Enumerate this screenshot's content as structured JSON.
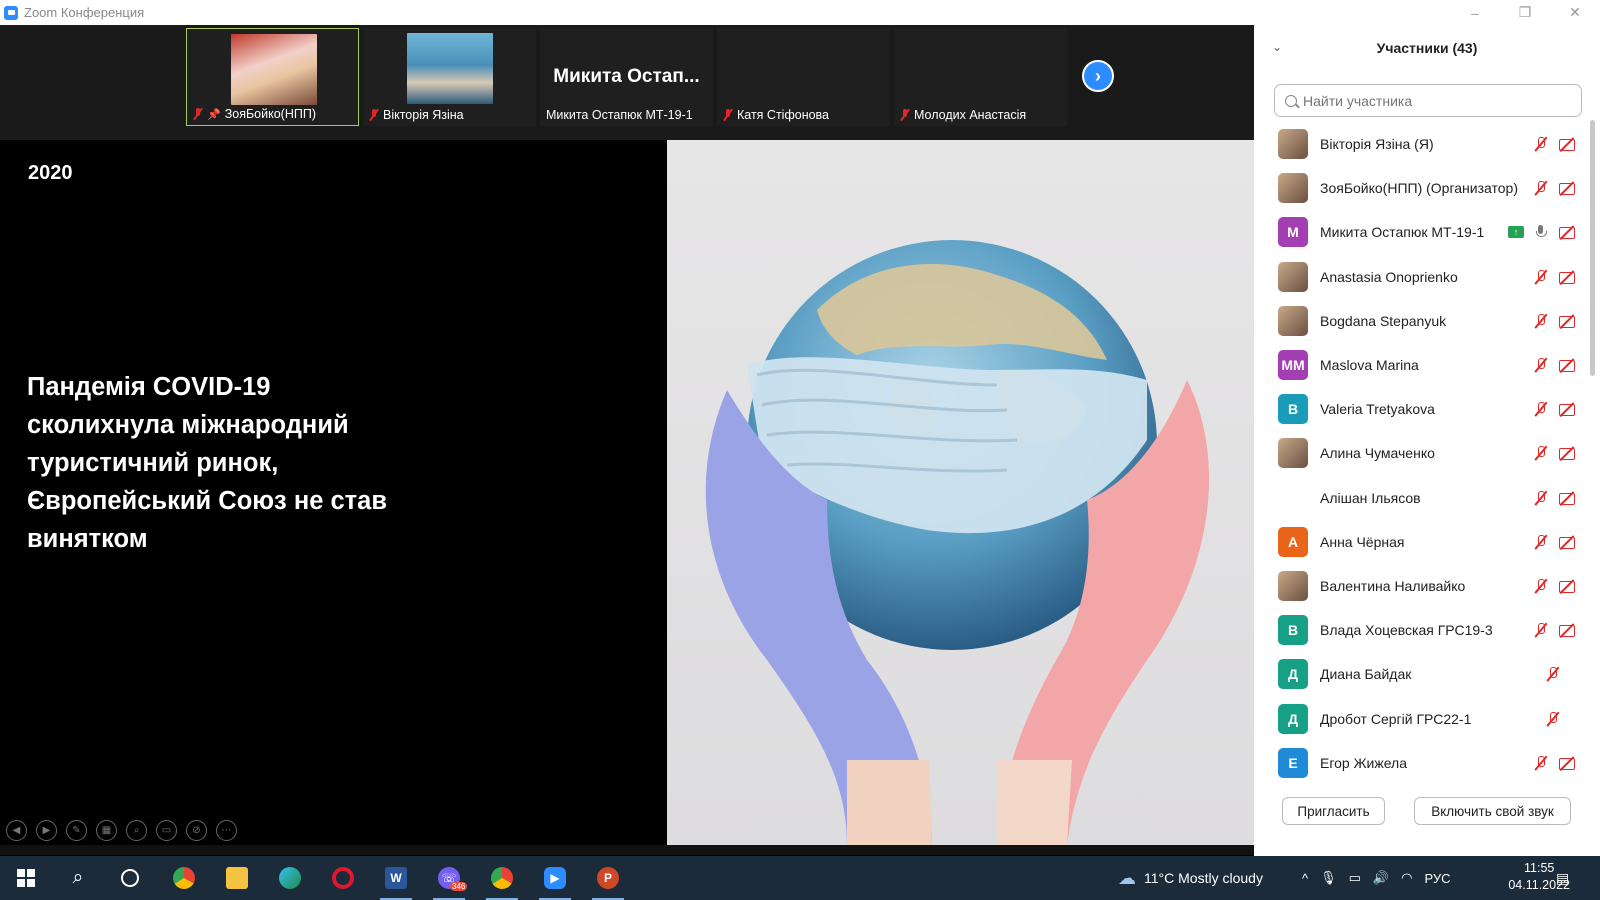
{
  "window": {
    "title": "Zoom Конференция"
  },
  "video_strip": {
    "tiles": [
      {
        "name": "ЗояБойко(НПП)",
        "big_name": "",
        "muted": true,
        "pinned": true,
        "has_video": true
      },
      {
        "name": "Вікторія Язіна",
        "big_name": "",
        "muted": true,
        "pinned": false,
        "has_video": true
      },
      {
        "name": "Микита Остапюк МТ-19-1",
        "big_name": "Микита Остап...",
        "muted": false,
        "pinned": false,
        "has_video": false
      },
      {
        "name": "Катя Стіфонова",
        "big_name": "",
        "muted": true,
        "pinned": false,
        "has_video": false
      },
      {
        "name": "Молодих Анастасія",
        "big_name": "",
        "muted": true,
        "pinned": false,
        "has_video": false
      }
    ]
  },
  "slide": {
    "year": "2020",
    "headline": "Пандемія COVID-19 сколихнула міжнародний туристичний ринок, Європейський Союз не став винятком"
  },
  "participants": {
    "title": "Участники (43)",
    "search_placeholder": "Найти участника",
    "list": [
      {
        "name": "Вікторія Язіна (Я)",
        "avatar": "",
        "avatar_color": "",
        "photo": true,
        "mic": "off",
        "cam": "off",
        "share": false
      },
      {
        "name": "ЗояБойко(НПП) (Организатор)",
        "avatar": "",
        "avatar_color": "",
        "photo": true,
        "mic": "off",
        "cam": "off",
        "share": false
      },
      {
        "name": "Микита Остапюк МТ-19-1",
        "avatar": "M",
        "avatar_color": "#a33eb3",
        "photo": false,
        "mic": "on",
        "cam": "off",
        "share": true
      },
      {
        "name": "Anastasia Onoprienko",
        "avatar": "",
        "avatar_color": "",
        "photo": true,
        "mic": "off",
        "cam": "off",
        "share": false
      },
      {
        "name": "Bogdana Stepanyuk",
        "avatar": "",
        "avatar_color": "",
        "photo": true,
        "mic": "off",
        "cam": "off",
        "share": false
      },
      {
        "name": "Maslova Marina",
        "avatar": "MM",
        "avatar_color": "#a33eb3",
        "photo": false,
        "mic": "off",
        "cam": "off",
        "share": false
      },
      {
        "name": "Valeria Tretyakova",
        "avatar": "В",
        "avatar_color": "#1a9cb8",
        "photo": false,
        "mic": "off",
        "cam": "off",
        "share": false
      },
      {
        "name": "Алина Чумаченко",
        "avatar": "",
        "avatar_color": "",
        "photo": true,
        "mic": "off",
        "cam": "off",
        "share": false
      },
      {
        "name": "Алішан Ільясов",
        "avatar": "",
        "avatar_color": "",
        "photo": false,
        "mic": "off",
        "cam": "off",
        "share": false
      },
      {
        "name": "Анна Чёрная",
        "avatar": "А",
        "avatar_color": "#e8651a",
        "photo": false,
        "mic": "off",
        "cam": "off",
        "share": false
      },
      {
        "name": "Валентина Наливайко",
        "avatar": "",
        "avatar_color": "",
        "photo": true,
        "mic": "off",
        "cam": "off",
        "share": false
      },
      {
        "name": "Влада Хоцевская ГРС19-3",
        "avatar": "В",
        "avatar_color": "#16a085",
        "photo": false,
        "mic": "off",
        "cam": "off",
        "share": false
      },
      {
        "name": "Диана Байдак",
        "avatar": "Д",
        "avatar_color": "#16a085",
        "photo": false,
        "mic": "off",
        "cam": "none",
        "share": false
      },
      {
        "name": "Дробот Сергій ГРС22-1",
        "avatar": "Д",
        "avatar_color": "#16a085",
        "photo": false,
        "mic": "off",
        "cam": "none",
        "share": false
      },
      {
        "name": "Егор Жижела",
        "avatar": "Е",
        "avatar_color": "#1f8ad6",
        "photo": false,
        "mic": "off",
        "cam": "off",
        "share": false
      }
    ],
    "invite_label": "Пригласить",
    "unmute_label": "Включить свой звук"
  },
  "taskbar": {
    "weather": "11°C  Mostly cloudy",
    "language": "РУС",
    "time": "11:55",
    "date": "04.11.2022",
    "viber_badge": "346"
  },
  "colors": {
    "zoom_blue": "#2d8cff",
    "muted_red": "#e02828",
    "taskbar": "#1c2b3a"
  }
}
